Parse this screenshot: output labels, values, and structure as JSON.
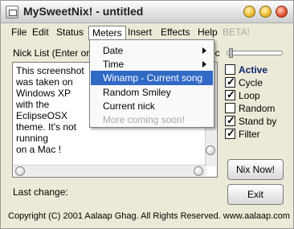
{
  "window": {
    "title": "MySweetNix! - untitled"
  },
  "menubar": {
    "items": [
      {
        "label": "File"
      },
      {
        "label": "Edit"
      },
      {
        "label": "Status"
      },
      {
        "label": "Meters"
      },
      {
        "label": "Insert"
      },
      {
        "label": "Effects"
      },
      {
        "label": "Help"
      },
      {
        "label": "BETA!"
      }
    ]
  },
  "meters_menu": {
    "items": [
      {
        "label": "Date",
        "submenu": true
      },
      {
        "label": "Time",
        "submenu": true
      },
      {
        "label": "Winamp - Current song",
        "highlighted": true
      },
      {
        "label": "Random Smiley"
      },
      {
        "label": "Current nick"
      },
      {
        "label": "More coming soon!",
        "disabled": true
      }
    ]
  },
  "nicklist": {
    "label": "Nick List (Enter one",
    "text": "This screenshot\nwas taken on\nWindows XP\nwith the\nEclipseOSX\ntheme. It's not\nrunning\non a Mac !"
  },
  "interval": {
    "label": "ec"
  },
  "options": [
    {
      "label": "Active",
      "checked": false,
      "bold": true
    },
    {
      "label": "Cycle",
      "checked": true
    },
    {
      "label": "Loop",
      "checked": true
    },
    {
      "label": "Random",
      "checked": false
    },
    {
      "label": "Stand by",
      "checked": true
    },
    {
      "label": "Filter",
      "checked": true
    }
  ],
  "status": {
    "last_change_label": "Last change:"
  },
  "buttons": {
    "nix_now": "Nix Now!",
    "exit": "Exit"
  },
  "footer": {
    "copyright": "Copyright (C) 2001 Aalaap Ghag. All Rights Reserved. www.aalaap.com"
  },
  "colors": {
    "highlight": "#316ac5",
    "window_bg": "#ece9d8",
    "close_button": "#d8401a",
    "minmax_button": "#e9b020"
  }
}
